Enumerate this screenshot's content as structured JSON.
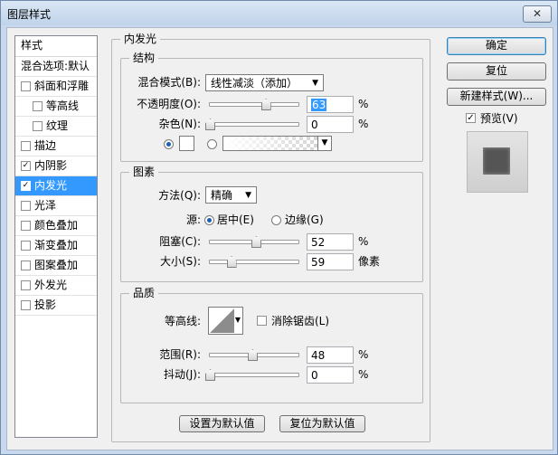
{
  "window": {
    "title": "图层样式",
    "close_label": "✕"
  },
  "style_list": {
    "header": "样式",
    "items": [
      {
        "label": "混合选项:默认",
        "checkbox": false,
        "checked": false,
        "sub": false
      },
      {
        "label": "斜面和浮雕",
        "checkbox": true,
        "checked": false,
        "sub": false
      },
      {
        "label": "等高线",
        "checkbox": true,
        "checked": false,
        "sub": true
      },
      {
        "label": "纹理",
        "checkbox": true,
        "checked": false,
        "sub": true
      },
      {
        "label": "描边",
        "checkbox": true,
        "checked": false,
        "sub": false
      },
      {
        "label": "内阴影",
        "checkbox": true,
        "checked": true,
        "sub": false
      },
      {
        "label": "内发光",
        "checkbox": true,
        "checked": true,
        "sub": false,
        "selected": true
      },
      {
        "label": "光泽",
        "checkbox": true,
        "checked": false,
        "sub": false
      },
      {
        "label": "颜色叠加",
        "checkbox": true,
        "checked": false,
        "sub": false
      },
      {
        "label": "渐变叠加",
        "checkbox": true,
        "checked": false,
        "sub": false
      },
      {
        "label": "图案叠加",
        "checkbox": true,
        "checked": false,
        "sub": false
      },
      {
        "label": "外发光",
        "checkbox": true,
        "checked": false,
        "sub": false
      },
      {
        "label": "投影",
        "checkbox": true,
        "checked": false,
        "sub": false
      }
    ]
  },
  "inner_glow": {
    "title": "内发光",
    "structure": {
      "title": "结构",
      "blend_mode_label": "混合模式(B):",
      "blend_mode_value": "线性减淡（添加）",
      "opacity_label": "不透明度(O):",
      "opacity_value": "63",
      "opacity_unit": "%",
      "opacity_level": 0.63,
      "noise_label": "杂色(N):",
      "noise_value": "0",
      "noise_unit": "%",
      "noise_level": 0.0
    },
    "elements": {
      "title": "图素",
      "method_label": "方法(Q):",
      "method_value": "精确",
      "source_label": "源:",
      "source_center": "居中(E)",
      "source_edge": "边缘(G)",
      "choke_label": "阻塞(C):",
      "choke_value": "52",
      "choke_unit": "%",
      "choke_level": 0.52,
      "size_label": "大小(S):",
      "size_value": "59",
      "size_unit": "像素",
      "size_level": 0.24
    },
    "quality": {
      "title": "品质",
      "contour_label": "等高线:",
      "anti_alias_label": "消除锯齿(L)",
      "range_label": "范围(R):",
      "range_value": "48",
      "range_unit": "%",
      "range_level": 0.48,
      "jitter_label": "抖动(J):",
      "jitter_value": "0",
      "jitter_unit": "%",
      "jitter_level": 0.0
    },
    "make_default": "设置为默认值",
    "reset_default": "复位为默认值"
  },
  "buttons": {
    "ok": "确定",
    "reset": "复位",
    "new_style": "新建样式(W)...",
    "preview": "预览(V)"
  }
}
